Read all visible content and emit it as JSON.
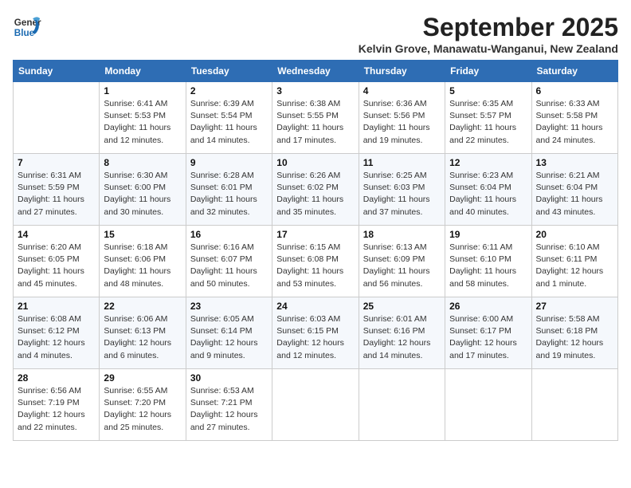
{
  "header": {
    "logo_line1": "General",
    "logo_line2": "Blue",
    "month": "September 2025",
    "location": "Kelvin Grove, Manawatu-Wanganui, New Zealand"
  },
  "days_of_week": [
    "Sunday",
    "Monday",
    "Tuesday",
    "Wednesday",
    "Thursday",
    "Friday",
    "Saturday"
  ],
  "weeks": [
    [
      {
        "day": "",
        "info": ""
      },
      {
        "day": "1",
        "info": "Sunrise: 6:41 AM\nSunset: 5:53 PM\nDaylight: 11 hours\nand 12 minutes."
      },
      {
        "day": "2",
        "info": "Sunrise: 6:39 AM\nSunset: 5:54 PM\nDaylight: 11 hours\nand 14 minutes."
      },
      {
        "day": "3",
        "info": "Sunrise: 6:38 AM\nSunset: 5:55 PM\nDaylight: 11 hours\nand 17 minutes."
      },
      {
        "day": "4",
        "info": "Sunrise: 6:36 AM\nSunset: 5:56 PM\nDaylight: 11 hours\nand 19 minutes."
      },
      {
        "day": "5",
        "info": "Sunrise: 6:35 AM\nSunset: 5:57 PM\nDaylight: 11 hours\nand 22 minutes."
      },
      {
        "day": "6",
        "info": "Sunrise: 6:33 AM\nSunset: 5:58 PM\nDaylight: 11 hours\nand 24 minutes."
      }
    ],
    [
      {
        "day": "7",
        "info": "Sunrise: 6:31 AM\nSunset: 5:59 PM\nDaylight: 11 hours\nand 27 minutes."
      },
      {
        "day": "8",
        "info": "Sunrise: 6:30 AM\nSunset: 6:00 PM\nDaylight: 11 hours\nand 30 minutes."
      },
      {
        "day": "9",
        "info": "Sunrise: 6:28 AM\nSunset: 6:01 PM\nDaylight: 11 hours\nand 32 minutes."
      },
      {
        "day": "10",
        "info": "Sunrise: 6:26 AM\nSunset: 6:02 PM\nDaylight: 11 hours\nand 35 minutes."
      },
      {
        "day": "11",
        "info": "Sunrise: 6:25 AM\nSunset: 6:03 PM\nDaylight: 11 hours\nand 37 minutes."
      },
      {
        "day": "12",
        "info": "Sunrise: 6:23 AM\nSunset: 6:04 PM\nDaylight: 11 hours\nand 40 minutes."
      },
      {
        "day": "13",
        "info": "Sunrise: 6:21 AM\nSunset: 6:04 PM\nDaylight: 11 hours\nand 43 minutes."
      }
    ],
    [
      {
        "day": "14",
        "info": "Sunrise: 6:20 AM\nSunset: 6:05 PM\nDaylight: 11 hours\nand 45 minutes."
      },
      {
        "day": "15",
        "info": "Sunrise: 6:18 AM\nSunset: 6:06 PM\nDaylight: 11 hours\nand 48 minutes."
      },
      {
        "day": "16",
        "info": "Sunrise: 6:16 AM\nSunset: 6:07 PM\nDaylight: 11 hours\nand 50 minutes."
      },
      {
        "day": "17",
        "info": "Sunrise: 6:15 AM\nSunset: 6:08 PM\nDaylight: 11 hours\nand 53 minutes."
      },
      {
        "day": "18",
        "info": "Sunrise: 6:13 AM\nSunset: 6:09 PM\nDaylight: 11 hours\nand 56 minutes."
      },
      {
        "day": "19",
        "info": "Sunrise: 6:11 AM\nSunset: 6:10 PM\nDaylight: 11 hours\nand 58 minutes."
      },
      {
        "day": "20",
        "info": "Sunrise: 6:10 AM\nSunset: 6:11 PM\nDaylight: 12 hours\nand 1 minute."
      }
    ],
    [
      {
        "day": "21",
        "info": "Sunrise: 6:08 AM\nSunset: 6:12 PM\nDaylight: 12 hours\nand 4 minutes."
      },
      {
        "day": "22",
        "info": "Sunrise: 6:06 AM\nSunset: 6:13 PM\nDaylight: 12 hours\nand 6 minutes."
      },
      {
        "day": "23",
        "info": "Sunrise: 6:05 AM\nSunset: 6:14 PM\nDaylight: 12 hours\nand 9 minutes."
      },
      {
        "day": "24",
        "info": "Sunrise: 6:03 AM\nSunset: 6:15 PM\nDaylight: 12 hours\nand 12 minutes."
      },
      {
        "day": "25",
        "info": "Sunrise: 6:01 AM\nSunset: 6:16 PM\nDaylight: 12 hours\nand 14 minutes."
      },
      {
        "day": "26",
        "info": "Sunrise: 6:00 AM\nSunset: 6:17 PM\nDaylight: 12 hours\nand 17 minutes."
      },
      {
        "day": "27",
        "info": "Sunrise: 5:58 AM\nSunset: 6:18 PM\nDaylight: 12 hours\nand 19 minutes."
      }
    ],
    [
      {
        "day": "28",
        "info": "Sunrise: 6:56 AM\nSunset: 7:19 PM\nDaylight: 12 hours\nand 22 minutes."
      },
      {
        "day": "29",
        "info": "Sunrise: 6:55 AM\nSunset: 7:20 PM\nDaylight: 12 hours\nand 25 minutes."
      },
      {
        "day": "30",
        "info": "Sunrise: 6:53 AM\nSunset: 7:21 PM\nDaylight: 12 hours\nand 27 minutes."
      },
      {
        "day": "",
        "info": ""
      },
      {
        "day": "",
        "info": ""
      },
      {
        "day": "",
        "info": ""
      },
      {
        "day": "",
        "info": ""
      }
    ]
  ]
}
